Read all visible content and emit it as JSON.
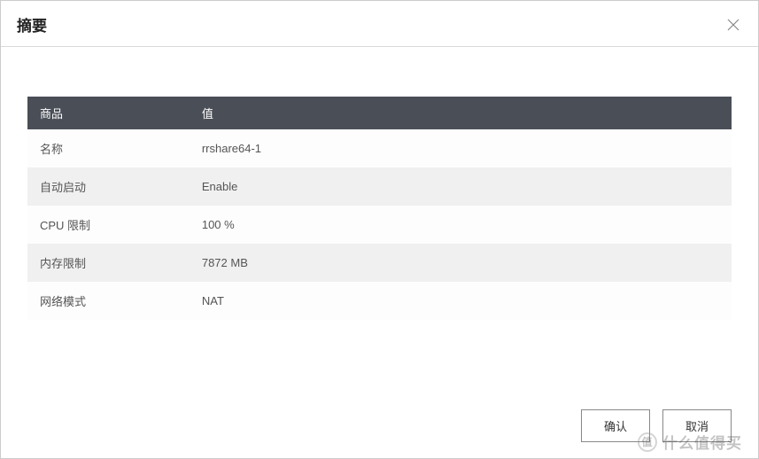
{
  "dialog": {
    "title": "摘要"
  },
  "table": {
    "headers": {
      "col1": "商品",
      "col2": "值"
    },
    "rows": [
      {
        "label": "名称",
        "value": "rrshare64-1"
      },
      {
        "label": "自动启动",
        "value": "Enable"
      },
      {
        "label": "CPU 限制",
        "value": "100 %"
      },
      {
        "label": "内存限制",
        "value": "7872 MB"
      },
      {
        "label": "网络模式",
        "value": "NAT"
      }
    ]
  },
  "buttons": {
    "ok": "确认",
    "cancel": "取消"
  },
  "watermark": {
    "badge": "值",
    "text": "什么值得买"
  }
}
